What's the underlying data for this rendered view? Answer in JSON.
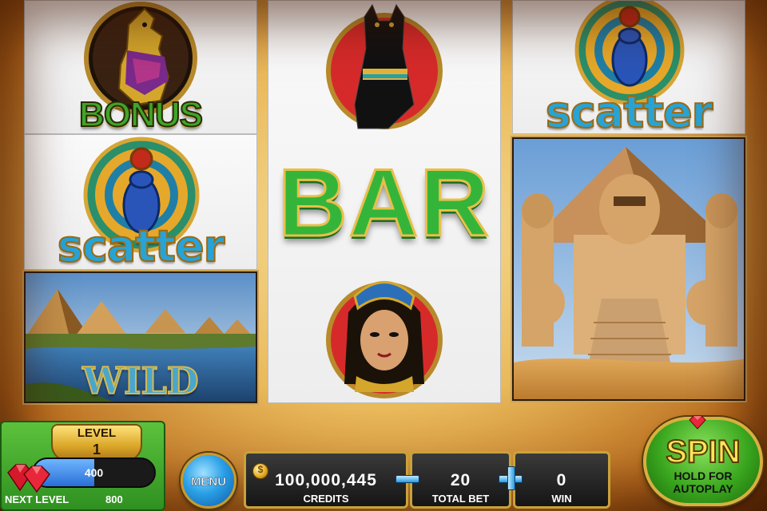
{
  "reels": {
    "reel1": {
      "top_label": "BONUS",
      "middle_label": "scatter",
      "bottom_label": "WILD"
    },
    "reel2": {
      "middle_label": "BAR"
    },
    "reel3": {
      "top_label": "scatter"
    }
  },
  "level": {
    "title": "LEVEL",
    "number": "1",
    "xp_value": "400",
    "xp_progress": 0.5,
    "next_level_label": "NEXT LEVEL",
    "next_level_value": "800"
  },
  "menu": {
    "label": "MENU"
  },
  "credits": {
    "value": "100,000,445",
    "label": "CREDITS"
  },
  "total_bet": {
    "value": "20",
    "label": "TOTAL BET"
  },
  "win": {
    "value": "0",
    "label": "WIN"
  },
  "spin": {
    "label": "SPIN",
    "sub_label": "HOLD FOR AUTOPLAY"
  },
  "colors": {
    "level_green": "#3aa61e",
    "xp_blue": "#2a6fd6",
    "gold_trim": "#c9a23a",
    "spin_text": "#ffe45a"
  },
  "icons": [
    "horus-falcon-icon",
    "scarab-icon",
    "bastet-cat-icon",
    "cleopatra-icon",
    "ruby-gem-icon",
    "coin-icon",
    "minus-icon",
    "plus-icon"
  ]
}
